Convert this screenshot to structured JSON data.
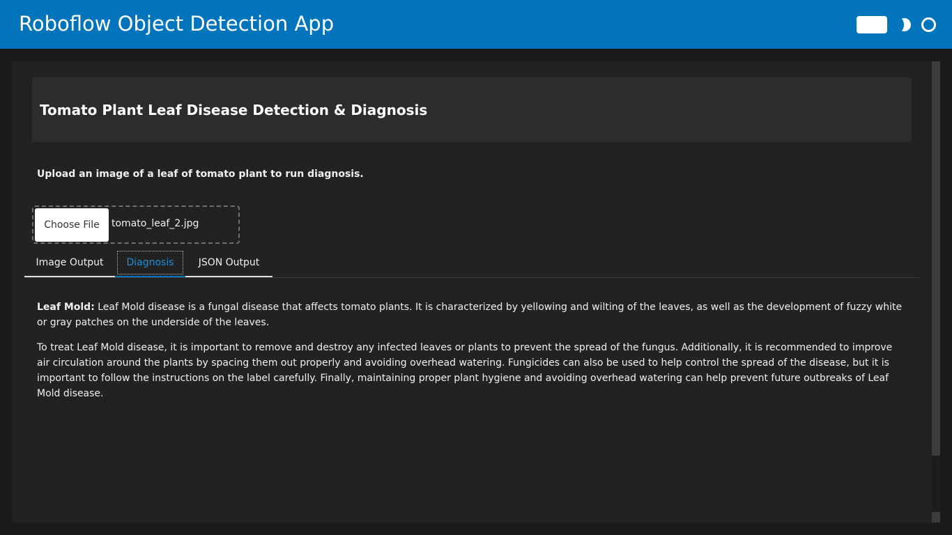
{
  "app": {
    "title": "Roboflow Object Detection App"
  },
  "header": {
    "title": "Tomato Plant Leaf Disease Detection & Diagnosis"
  },
  "upload": {
    "instruction": "Upload an image of a leaf of tomato plant to run diagnosis.",
    "button_label": "Choose File",
    "file_name": "tomato_leaf_2.jpg"
  },
  "tabs": [
    {
      "label": "Image Output",
      "active": false
    },
    {
      "label": "Diagnosis",
      "active": true
    },
    {
      "label": "JSON Output",
      "active": false
    }
  ],
  "diagnosis": {
    "disease_label": "Leaf Mold:",
    "description": " Leaf Mold disease is a fungal disease that affects tomato plants. It is characterized by yellowing and wilting of the leaves, as well as the development of fuzzy white or gray patches on the underside of the leaves.",
    "treatment": "To treat Leaf Mold disease, it is important to remove and destroy any infected leaves or plants to prevent the spread of the fungus. Additionally, it is recommended to improve air circulation around the plants by spacing them out properly and avoiding overhead watering. Fungicides can also be used to help control the spread of the disease, but it is important to follow the instructions on the label carefully. Finally, maintaining proper plant hygiene and avoiding overhead watering can help prevent future outbreaks of Leaf Mold disease."
  },
  "icons": {
    "theme_toggle": "toggle-switch-icon",
    "dark_mode": "moon-icon",
    "settings": "circle-icon"
  },
  "colors": {
    "brand": "#0274bb",
    "panel": "#222222",
    "card": "#2c2c2c",
    "active_tab": "#1e8fd6"
  }
}
